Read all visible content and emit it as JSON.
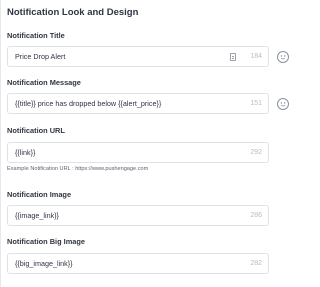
{
  "section": {
    "title": "Notification Look and Design"
  },
  "fields": {
    "title": {
      "label": "Notification Title",
      "value": "Price Drop Alert",
      "count": "184"
    },
    "message": {
      "label": "Notification Message",
      "value": "{{title}} price has dropped below {{alert_price}}",
      "count": "151"
    },
    "url": {
      "label": "Notification URL",
      "value": "{{link}}",
      "count": "292",
      "helper_prefix": "Example Notification URL : ",
      "helper_url": "https://www.pushengage.com"
    },
    "image": {
      "label": "Notification Image",
      "value": "{{image_link}}",
      "count": "286"
    },
    "big_image": {
      "label": "Notification Big Image",
      "value": "{{big_image_link}}",
      "count": "282"
    }
  },
  "icons": {
    "emoji": "smiley-icon",
    "template": "document-icon"
  }
}
